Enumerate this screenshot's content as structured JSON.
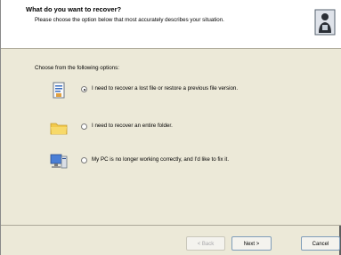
{
  "header": {
    "title": "What do you want to recover?",
    "subtitle": "Please choose the option below that most accurately describes your situation."
  },
  "prompt": "Choose from the following options:",
  "options": [
    {
      "label": "I need to recover a lost file or restore a previous file version.",
      "selected": true,
      "icon": "document-icon"
    },
    {
      "label": "I need to recover an entire folder.",
      "selected": false,
      "icon": "folder-icon"
    },
    {
      "label": "My PC is no longer working correctly, and I'd like to fix it.",
      "selected": false,
      "icon": "computer-icon"
    }
  ],
  "buttons": {
    "back": "< Back",
    "next": "Next >",
    "cancel": "Cancel"
  }
}
